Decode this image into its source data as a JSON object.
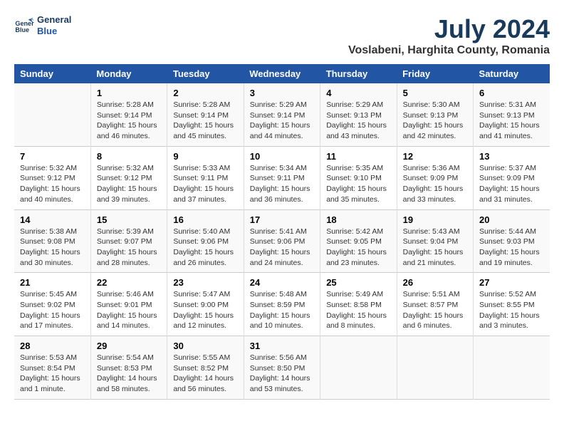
{
  "header": {
    "logo_line1": "General",
    "logo_line2": "Blue",
    "title": "July 2024",
    "subtitle": "Voslabeni, Harghita County, Romania"
  },
  "days_of_week": [
    "Sunday",
    "Monday",
    "Tuesday",
    "Wednesday",
    "Thursday",
    "Friday",
    "Saturday"
  ],
  "weeks": [
    [
      {
        "day": "",
        "details": ""
      },
      {
        "day": "1",
        "details": "Sunrise: 5:28 AM\nSunset: 9:14 PM\nDaylight: 15 hours\nand 46 minutes."
      },
      {
        "day": "2",
        "details": "Sunrise: 5:28 AM\nSunset: 9:14 PM\nDaylight: 15 hours\nand 45 minutes."
      },
      {
        "day": "3",
        "details": "Sunrise: 5:29 AM\nSunset: 9:14 PM\nDaylight: 15 hours\nand 44 minutes."
      },
      {
        "day": "4",
        "details": "Sunrise: 5:29 AM\nSunset: 9:13 PM\nDaylight: 15 hours\nand 43 minutes."
      },
      {
        "day": "5",
        "details": "Sunrise: 5:30 AM\nSunset: 9:13 PM\nDaylight: 15 hours\nand 42 minutes."
      },
      {
        "day": "6",
        "details": "Sunrise: 5:31 AM\nSunset: 9:13 PM\nDaylight: 15 hours\nand 41 minutes."
      }
    ],
    [
      {
        "day": "7",
        "details": "Sunrise: 5:32 AM\nSunset: 9:12 PM\nDaylight: 15 hours\nand 40 minutes."
      },
      {
        "day": "8",
        "details": "Sunrise: 5:32 AM\nSunset: 9:12 PM\nDaylight: 15 hours\nand 39 minutes."
      },
      {
        "day": "9",
        "details": "Sunrise: 5:33 AM\nSunset: 9:11 PM\nDaylight: 15 hours\nand 37 minutes."
      },
      {
        "day": "10",
        "details": "Sunrise: 5:34 AM\nSunset: 9:11 PM\nDaylight: 15 hours\nand 36 minutes."
      },
      {
        "day": "11",
        "details": "Sunrise: 5:35 AM\nSunset: 9:10 PM\nDaylight: 15 hours\nand 35 minutes."
      },
      {
        "day": "12",
        "details": "Sunrise: 5:36 AM\nSunset: 9:09 PM\nDaylight: 15 hours\nand 33 minutes."
      },
      {
        "day": "13",
        "details": "Sunrise: 5:37 AM\nSunset: 9:09 PM\nDaylight: 15 hours\nand 31 minutes."
      }
    ],
    [
      {
        "day": "14",
        "details": "Sunrise: 5:38 AM\nSunset: 9:08 PM\nDaylight: 15 hours\nand 30 minutes."
      },
      {
        "day": "15",
        "details": "Sunrise: 5:39 AM\nSunset: 9:07 PM\nDaylight: 15 hours\nand 28 minutes."
      },
      {
        "day": "16",
        "details": "Sunrise: 5:40 AM\nSunset: 9:06 PM\nDaylight: 15 hours\nand 26 minutes."
      },
      {
        "day": "17",
        "details": "Sunrise: 5:41 AM\nSunset: 9:06 PM\nDaylight: 15 hours\nand 24 minutes."
      },
      {
        "day": "18",
        "details": "Sunrise: 5:42 AM\nSunset: 9:05 PM\nDaylight: 15 hours\nand 23 minutes."
      },
      {
        "day": "19",
        "details": "Sunrise: 5:43 AM\nSunset: 9:04 PM\nDaylight: 15 hours\nand 21 minutes."
      },
      {
        "day": "20",
        "details": "Sunrise: 5:44 AM\nSunset: 9:03 PM\nDaylight: 15 hours\nand 19 minutes."
      }
    ],
    [
      {
        "day": "21",
        "details": "Sunrise: 5:45 AM\nSunset: 9:02 PM\nDaylight: 15 hours\nand 17 minutes."
      },
      {
        "day": "22",
        "details": "Sunrise: 5:46 AM\nSunset: 9:01 PM\nDaylight: 15 hours\nand 14 minutes."
      },
      {
        "day": "23",
        "details": "Sunrise: 5:47 AM\nSunset: 9:00 PM\nDaylight: 15 hours\nand 12 minutes."
      },
      {
        "day": "24",
        "details": "Sunrise: 5:48 AM\nSunset: 8:59 PM\nDaylight: 15 hours\nand 10 minutes."
      },
      {
        "day": "25",
        "details": "Sunrise: 5:49 AM\nSunset: 8:58 PM\nDaylight: 15 hours\nand 8 minutes."
      },
      {
        "day": "26",
        "details": "Sunrise: 5:51 AM\nSunset: 8:57 PM\nDaylight: 15 hours\nand 6 minutes."
      },
      {
        "day": "27",
        "details": "Sunrise: 5:52 AM\nSunset: 8:55 PM\nDaylight: 15 hours\nand 3 minutes."
      }
    ],
    [
      {
        "day": "28",
        "details": "Sunrise: 5:53 AM\nSunset: 8:54 PM\nDaylight: 15 hours\nand 1 minute."
      },
      {
        "day": "29",
        "details": "Sunrise: 5:54 AM\nSunset: 8:53 PM\nDaylight: 14 hours\nand 58 minutes."
      },
      {
        "day": "30",
        "details": "Sunrise: 5:55 AM\nSunset: 8:52 PM\nDaylight: 14 hours\nand 56 minutes."
      },
      {
        "day": "31",
        "details": "Sunrise: 5:56 AM\nSunset: 8:50 PM\nDaylight: 14 hours\nand 53 minutes."
      },
      {
        "day": "",
        "details": ""
      },
      {
        "day": "",
        "details": ""
      },
      {
        "day": "",
        "details": ""
      }
    ]
  ]
}
